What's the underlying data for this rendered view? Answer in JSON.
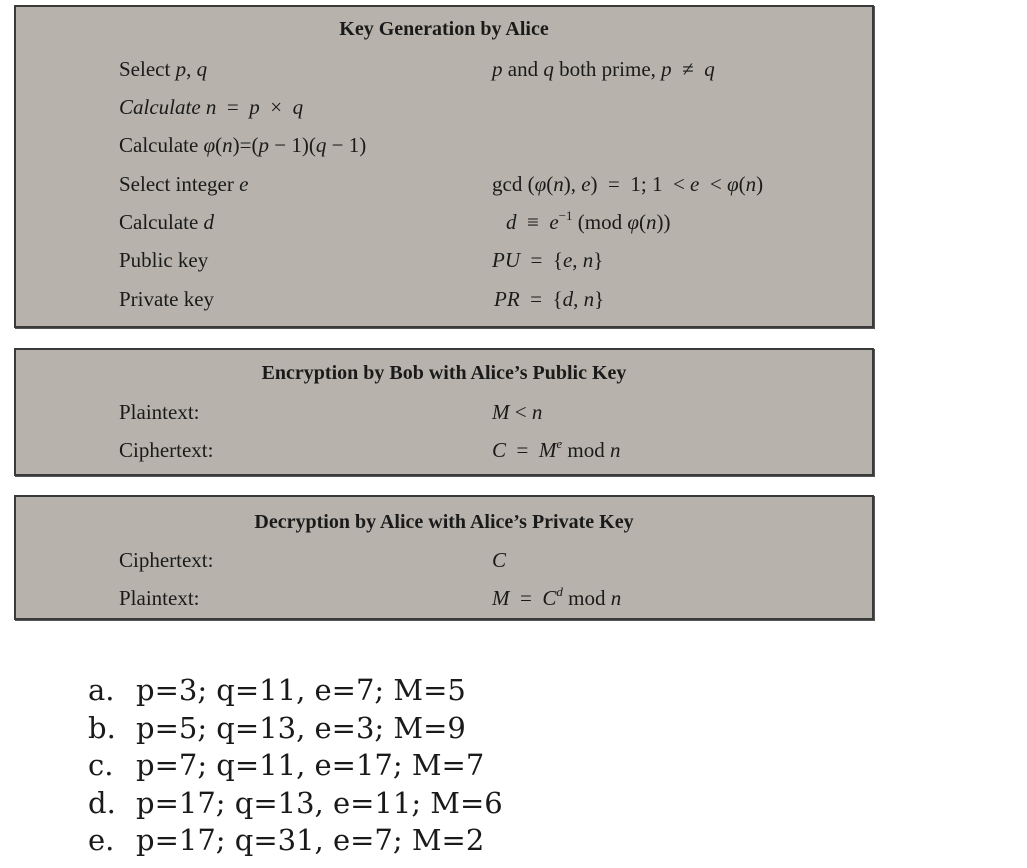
{
  "key_generation": {
    "title": "Key Generation by Alice",
    "rows": [
      {
        "label_plain": "Select ",
        "label_math": "p, q",
        "value_html": "<i>p</i> and <i>q</i> both prime, <i>p</i> &ne; <i>q</i>"
      },
      {
        "label_html": "<i>Calculate n</i> &nbsp;= &nbsp;<i>p</i> &nbsp;&times; <i>q</i>",
        "value_html": ""
      },
      {
        "label_html": "Calculate <i>&phi;</i>(<i>n</i>)=(<i>p</i> &minus; 1)(<i>q</i> &minus; 1)",
        "value_html": ""
      },
      {
        "label_html": "Select integer <i>e</i>",
        "value_html": "gcd (<i>&phi;</i>(<i>n</i>), <i>e</i>) &nbsp;= &nbsp;1; 1 &nbsp;&lt; <i>e</i> &nbsp;&lt; <i>&phi;</i>(<i>n</i>)"
      },
      {
        "label_html": "Calculate <i>d</i>",
        "value_html": "<i>d</i> &nbsp;&equiv; <i>e</i><sup>&minus;1</sup> (mod <i>&phi;</i>(<i>n</i>))"
      },
      {
        "label_html": "Public key",
        "value_html": "<i>PU</i> &nbsp;= &nbsp;{<i>e</i>, <i>n</i>}"
      },
      {
        "label_html": "Private key",
        "value_html": "<i>PR</i> &nbsp;= &nbsp;{<i>d</i>, <i>n</i>}"
      }
    ],
    "labels": [
      "Select p, q",
      "Calculate n = p × q",
      "Calculate φ(n)=(p − 1)(q − 1)",
      "Select integer e",
      "Calculate d",
      "Public key",
      "Private key"
    ],
    "values": [
      "p and q both prime, p ≠ q",
      "",
      "",
      "gcd (φ(n), e) = 1; 1 < e < φ(n)",
      "d ≡ e^−1 (mod φ(n))",
      "PU = {e, n}",
      "PR = {d, n}"
    ]
  },
  "encryption": {
    "title": "Encryption by Bob with Alice’s Public Key",
    "labels": [
      "Plaintext:",
      "Ciphertext:"
    ],
    "values": [
      "M < n",
      "C = M^e mod n"
    ]
  },
  "decryption": {
    "title": "Decryption by Alice with Alice’s Private Key",
    "labels": [
      "Ciphertext:",
      "Plaintext:"
    ],
    "values": [
      "C",
      "M = C^d mod n"
    ]
  },
  "exercises": [
    {
      "marker": "a.",
      "text": "p=3; q=11, e=7; M=5"
    },
    {
      "marker": "b.",
      "text": "p=5; q=13, e=3; M=9"
    },
    {
      "marker": "c.",
      "text": "p=7; q=11, e=17; M=7"
    },
    {
      "marker": "d.",
      "text": "p=17; q=13, e=11; M=6"
    },
    {
      "marker": "e.",
      "text": "p=17; q=31, e=7; M=2"
    }
  ]
}
